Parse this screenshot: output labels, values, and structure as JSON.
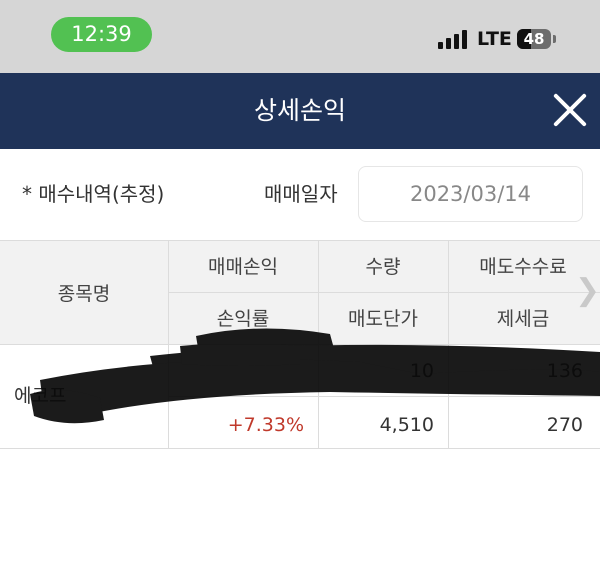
{
  "status_bar": {
    "time": "12:39",
    "network": "LTE",
    "battery": "48"
  },
  "header": {
    "title": "상세손익"
  },
  "filters": {
    "purchase_history_label": "* 매수내역(추정)",
    "trade_date_label": "매매일자",
    "trade_date_value": "2023/03/14"
  },
  "table": {
    "headers": {
      "stock_name": "종목명",
      "trade_pl": "매매손익",
      "quantity": "수량",
      "sell_commission": "매도수수료",
      "pl_rate": "손익률",
      "sell_price": "매도단가",
      "taxes": "제세금"
    },
    "row": {
      "stock_name": "에코프",
      "trade_pl": "",
      "quantity": "10",
      "sell_commission": "136",
      "pl_rate": "+7.33%",
      "sell_price": "4,510",
      "taxes": "270"
    }
  },
  "colors": {
    "header_bg": "#1f3359",
    "positive": "#c0392b",
    "status_pill": "#52c152"
  }
}
